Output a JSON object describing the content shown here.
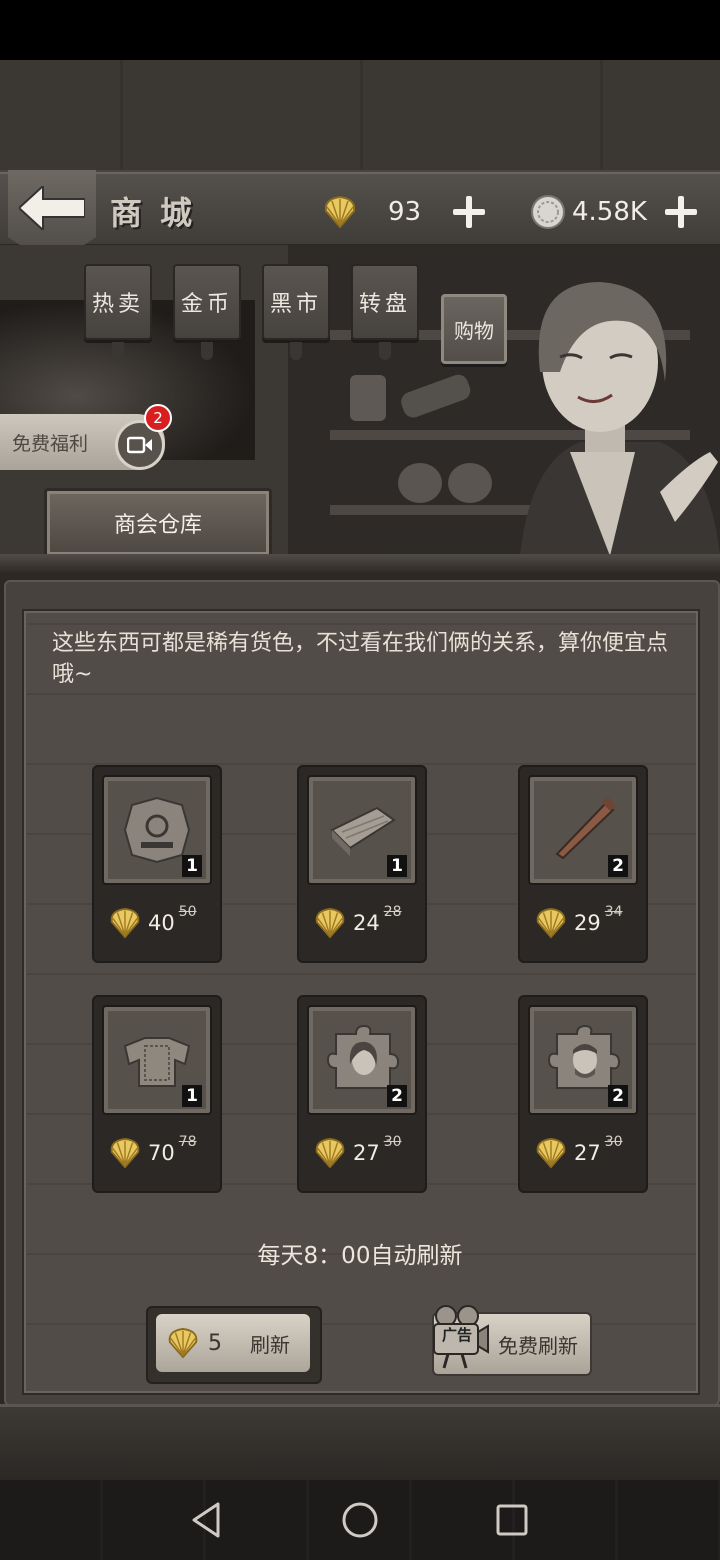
{
  "header": {
    "title": "商城",
    "shells": "93",
    "silver": "4.58K"
  },
  "tabs": [
    {
      "label": "热卖"
    },
    {
      "label": "金币"
    },
    {
      "label": "黑市"
    },
    {
      "label": "转盘"
    },
    {
      "label": "购物",
      "active": true
    }
  ],
  "welfare": {
    "label": "免费福利",
    "badge": "2"
  },
  "warehouse": {
    "label": "商会仓库"
  },
  "dialog": "这些东西可都是稀有货色，不过看在我们俩的关系，算你便宜点哦~",
  "items": [
    {
      "icon": "emblem-puzzle-icon",
      "qty": "1",
      "price": "40",
      "old": "50"
    },
    {
      "icon": "wood-plank-icon",
      "qty": "1",
      "price": "24",
      "old": "28"
    },
    {
      "icon": "rusty-nail-icon",
      "qty": "2",
      "price": "29",
      "old": "34"
    },
    {
      "icon": "armor-vest-icon",
      "qty": "1",
      "price": "70",
      "old": "78"
    },
    {
      "icon": "woman-portrait-puzzle-icon",
      "qty": "2",
      "price": "27",
      "old": "30"
    },
    {
      "icon": "man-portrait-puzzle-icon",
      "qty": "2",
      "price": "27",
      "old": "30"
    }
  ],
  "refresh": {
    "note": "每天8：00自动刷新",
    "cost": "5",
    "paid_label": "刷新",
    "ad_label": "广告",
    "free_label": "免费刷新"
  },
  "colors": {
    "shell": "#e8c860",
    "badge": "#d81e1e"
  }
}
